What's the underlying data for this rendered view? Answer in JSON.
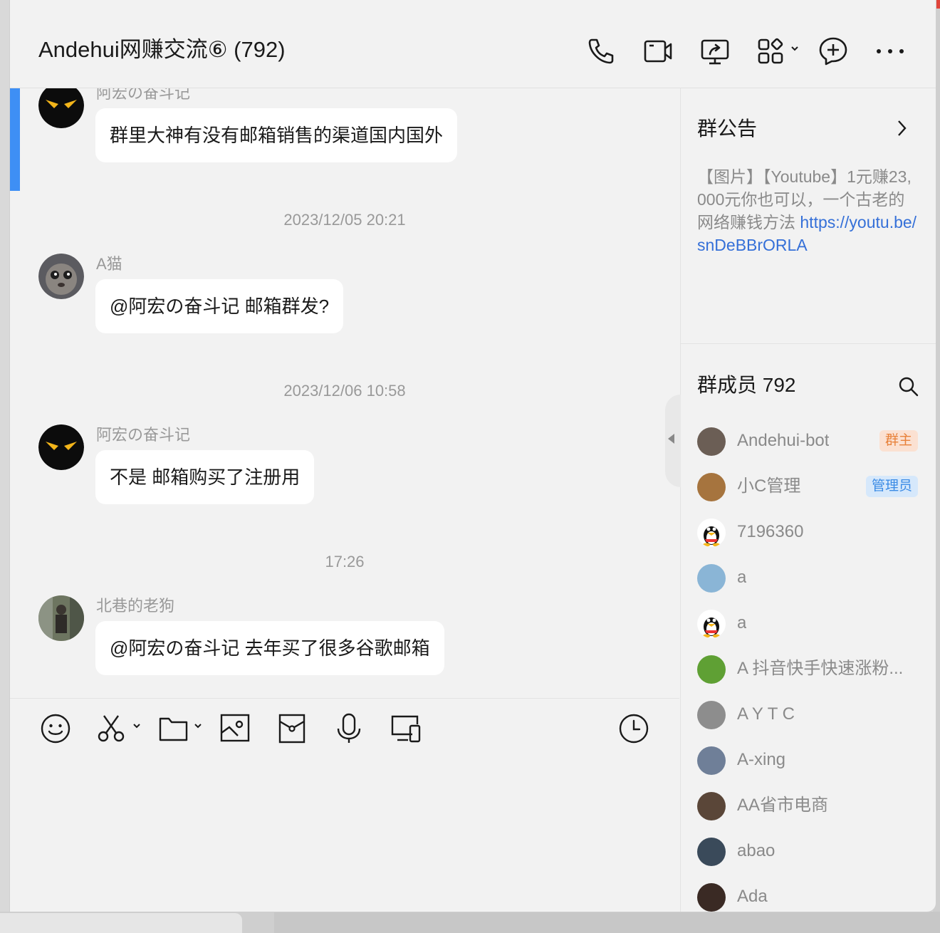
{
  "window": {
    "title": "Andehui网赚交流⑥ (792)"
  },
  "header_icons": [
    "phone-icon",
    "video-icon",
    "screen-share-icon",
    "apps-icon",
    "add-chat-icon",
    "more-icon"
  ],
  "messages": [
    {
      "sender": "阿宏の奋斗记",
      "text": "群里大神有没有邮箱销售的渠道国内国外",
      "avatar": "ninja"
    },
    {
      "timestamp": "2023/12/05 20:21"
    },
    {
      "sender": "A猫",
      "text": "@阿宏の奋斗记 邮箱群发?",
      "avatar": "cat"
    },
    {
      "timestamp": "2023/12/06 10:58"
    },
    {
      "sender": "阿宏の奋斗记",
      "text": "不是  邮箱购买了注册用",
      "avatar": "ninja"
    },
    {
      "timestamp": "17:26"
    },
    {
      "sender": "北巷的老狗",
      "text": "@阿宏の奋斗记 去年买了很多谷歌邮箱",
      "avatar": "photo"
    }
  ],
  "toolbar_icons": [
    "emoji-icon",
    "scissors-icon",
    "folder-icon",
    "image-icon",
    "red-packet-icon",
    "microphone-icon",
    "screen-icon",
    "history-icon"
  ],
  "announcement": {
    "title": "群公告",
    "text": "【图片】【Youtube】1元赚23,000元你也可以，一个古老的网络赚钱方法 ",
    "link": "https://youtu.be/snDeBBrORLA"
  },
  "members_title": "群成员 792",
  "members": [
    {
      "name": "Andehui-bot",
      "badge": "群主",
      "avatar_color": "#6b5e55"
    },
    {
      "name": "小C管理",
      "badge": "管理员",
      "avatar_color": "#a6743e"
    },
    {
      "name": "7196360",
      "badge": "",
      "avatar_color": "qq"
    },
    {
      "name": "a",
      "badge": "",
      "avatar_color": "#8ab5d6"
    },
    {
      "name": "a",
      "badge": "",
      "avatar_color": "qq"
    },
    {
      "name": "A 抖音快手快速涨粉...",
      "badge": "",
      "avatar_color": "#5fa034"
    },
    {
      "name": "A Y T C",
      "badge": "",
      "avatar_color": "#8d8d8d"
    },
    {
      "name": "A-xing",
      "badge": "",
      "avatar_color": "#6f7f98"
    },
    {
      "name": "AA省市电商",
      "badge": "",
      "avatar_color": "#5a4638"
    },
    {
      "name": "abao",
      "badge": "",
      "avatar_color": "#3a4a5a"
    },
    {
      "name": "Ada",
      "badge": "",
      "avatar_color": "#3a2a24"
    }
  ]
}
